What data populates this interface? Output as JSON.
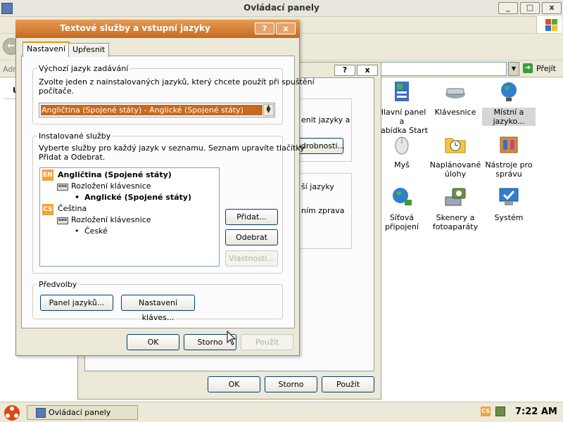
{
  "control_panel": {
    "title": "Ovládací panely",
    "window_buttons": {
      "minimize": "_",
      "maximize": "□",
      "close": "x"
    },
    "address_label": "Adr",
    "go_label": "Přejít",
    "left_letter": "U",
    "icons": [
      {
        "name": "start-menu-icon",
        "line1": "Hlavní panel a",
        "line2": "nabídka Start"
      },
      {
        "name": "keyboard-icon",
        "line1": "Klávesnice",
        "line2": ""
      },
      {
        "name": "globe-icon",
        "line1": "Místní a",
        "line2": "jazyko..."
      },
      {
        "name": "mouse-icon",
        "line1": "Myš",
        "line2": ""
      },
      {
        "name": "scheduled-tasks-icon",
        "line1": "Naplánované",
        "line2": "úlohy"
      },
      {
        "name": "admin-tools-icon",
        "line1": "Nástroje pro",
        "line2": "správu"
      },
      {
        "name": "network-icon",
        "line1": "Síťová",
        "line2": "připojení"
      },
      {
        "name": "scanner-camera-icon",
        "line1": "Skenery a",
        "line2": "fotoaparáty"
      },
      {
        "name": "system-icon",
        "line1": "Systém",
        "line2": ""
      }
    ]
  },
  "regional_dialog": {
    "help": "?",
    "close": "x",
    "text1a": "enit jazyky a",
    "details_button": "odrobnosti...",
    "text2a": "ší jazyky",
    "text2b": "ním zprava",
    "ok": "OK",
    "cancel": "Storno",
    "apply": "Použít"
  },
  "text_services_dialog": {
    "title": "Textové služby a vstupní jazyky",
    "help": "?",
    "close": "x",
    "tabs": [
      "Nastavení",
      "Upřesnit"
    ],
    "default_lang_group": "Výchozí jazyk zadávání",
    "default_lang_desc_1": "Zvolte jeden z nainstalovaných jazyků, který chcete použít při spuštění",
    "default_lang_desc_2": "počítače.",
    "default_lang_value": "Angličtina (Spojené státy) - Anglické (Spojené státy)",
    "installed_group": "Instalované služby",
    "installed_desc_1": "Vyberte služby pro každý jazyk v seznamu. Seznam upravíte tlačítky",
    "installed_desc_2": "Přidat a Odebrat.",
    "tree": {
      "en_badge": "EN",
      "en_label": "Angličtina (Spojené státy)",
      "en_layout_header": "Rozložení klávesnice",
      "en_layout": "Anglické (Spojené státy)",
      "cs_badge": "CS",
      "cs_label": "Čeština",
      "cs_layout_header": "Rozložení klávesnice",
      "cs_layout": "České"
    },
    "add_button": "Přidat...",
    "remove_button": "Odebrat",
    "properties_button": "Vlastnosti...",
    "prefs_group": "Předvolby",
    "language_bar_button": "Panel jazyků...",
    "key_settings_button": "Nastavení kláves...",
    "ok": "OK",
    "cancel": "Storno",
    "apply": "Použít"
  },
  "taskbar": {
    "task_label": "Ovládací panely",
    "tray_lang": "CS",
    "clock": "7:22 AM"
  },
  "colors": {
    "title_orange": "#c7691e",
    "selection_orange": "#c7691e",
    "badge_orange": "#f2a33a"
  }
}
